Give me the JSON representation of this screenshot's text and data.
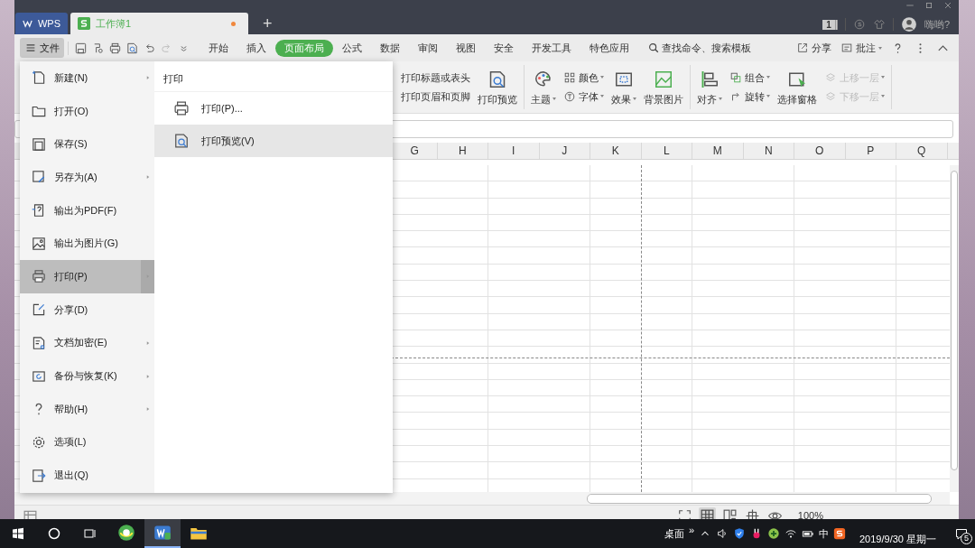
{
  "tabs": [
    {
      "label": "WPS",
      "kind": "app",
      "selected": false,
      "modified": false
    },
    {
      "label": "工作簿1",
      "kind": "doc",
      "selected": true,
      "modified": true
    }
  ],
  "new_tab": "+",
  "title_bar": {
    "badge": "1",
    "user": "嗨哟?"
  },
  "menu_button": "文件",
  "ribbon_tabs": [
    {
      "label": "开始",
      "selected": false
    },
    {
      "label": "插入",
      "selected": false
    },
    {
      "label": "页面布局",
      "selected": true
    },
    {
      "label": "公式",
      "selected": false
    },
    {
      "label": "数据",
      "selected": false
    },
    {
      "label": "审阅",
      "selected": false
    },
    {
      "label": "视图",
      "selected": false
    },
    {
      "label": "安全",
      "selected": false
    },
    {
      "label": "开发工具",
      "selected": false
    },
    {
      "label": "特色应用",
      "selected": false
    }
  ],
  "search": {
    "placeholder": "查找命令、搜索模板"
  },
  "toolbar_right": [
    "分享",
    "批注"
  ],
  "ribbon": [
    {
      "items": [
        {
          "kind": "text",
          "label": "打印标题或表头",
          "dropdown": false,
          "disabled": false
        },
        {
          "kind": "text",
          "label": "打印页眉和页脚",
          "dropdown": false,
          "disabled": false
        },
        {
          "kind": "large",
          "label": "打印预览",
          "dropdown": false,
          "disabled": false
        }
      ]
    },
    {
      "items": [
        {
          "kind": "large",
          "label": "主题",
          "dropdown": true,
          "disabled": false
        },
        {
          "kind": "small",
          "label": "颜色",
          "dropdown": true,
          "disabled": false
        },
        {
          "kind": "small",
          "label": "字体",
          "dropdown": true,
          "disabled": false
        },
        {
          "kind": "large",
          "label": "效果",
          "dropdown": true,
          "disabled": false
        },
        {
          "kind": "large",
          "label": "背景图片",
          "dropdown": false,
          "disabled": false
        }
      ]
    },
    {
      "items": [
        {
          "kind": "large",
          "label": "对齐",
          "dropdown": true,
          "disabled": false
        },
        {
          "kind": "small",
          "label": "组合",
          "dropdown": true,
          "disabled": false
        },
        {
          "kind": "small",
          "label": "旋转",
          "dropdown": true,
          "disabled": false
        },
        {
          "kind": "large",
          "label": "选择窗格",
          "dropdown": false,
          "disabled": false
        },
        {
          "kind": "small",
          "label": "上移一层",
          "dropdown": true,
          "disabled": true
        },
        {
          "kind": "small",
          "label": "下移一层",
          "dropdown": true,
          "disabled": true
        }
      ]
    }
  ],
  "columns": [
    "G",
    "H",
    "I",
    "J",
    "K",
    "L",
    "M",
    "N",
    "O",
    "P",
    "Q"
  ],
  "file_menu": [
    {
      "label": "新建(N)",
      "submenu": true,
      "selected": false
    },
    {
      "label": "打开(O)",
      "submenu": false,
      "selected": false
    },
    {
      "label": "保存(S)",
      "submenu": false,
      "selected": false
    },
    {
      "label": "另存为(A)",
      "submenu": true,
      "selected": false
    },
    {
      "label": "输出为PDF(F)",
      "submenu": false,
      "selected": false
    },
    {
      "label": "输出为图片(G)",
      "submenu": false,
      "selected": false
    },
    {
      "label": "打印(P)",
      "submenu": true,
      "selected": true
    },
    {
      "label": "分享(D)",
      "submenu": false,
      "selected": false
    },
    {
      "label": "文档加密(E)",
      "submenu": true,
      "selected": false
    },
    {
      "label": "备份与恢复(K)",
      "submenu": true,
      "selected": false
    },
    {
      "label": "帮助(H)",
      "submenu": true,
      "selected": false
    },
    {
      "label": "选项(L)",
      "submenu": false,
      "selected": false
    },
    {
      "label": "退出(Q)",
      "submenu": false,
      "selected": false
    }
  ],
  "submenu": {
    "title": "打印",
    "items": [
      {
        "label": "打印(P)...",
        "selected": false
      },
      {
        "label": "打印预览(V)",
        "selected": true
      }
    ]
  },
  "status_bar": {
    "views": [
      {
        "selected": false
      },
      {
        "selected": true
      },
      {
        "selected": false
      },
      {
        "selected": false
      },
      {
        "selected": false
      }
    ],
    "zoom": "100%"
  },
  "taskbar": {
    "apps": [
      {
        "active": false
      },
      {
        "active": true
      },
      {
        "active": false
      }
    ],
    "desktop": "桌面",
    "overflow": "»",
    "ime": "中",
    "date": "2019/9/30 星期一",
    "notifications": "5"
  }
}
